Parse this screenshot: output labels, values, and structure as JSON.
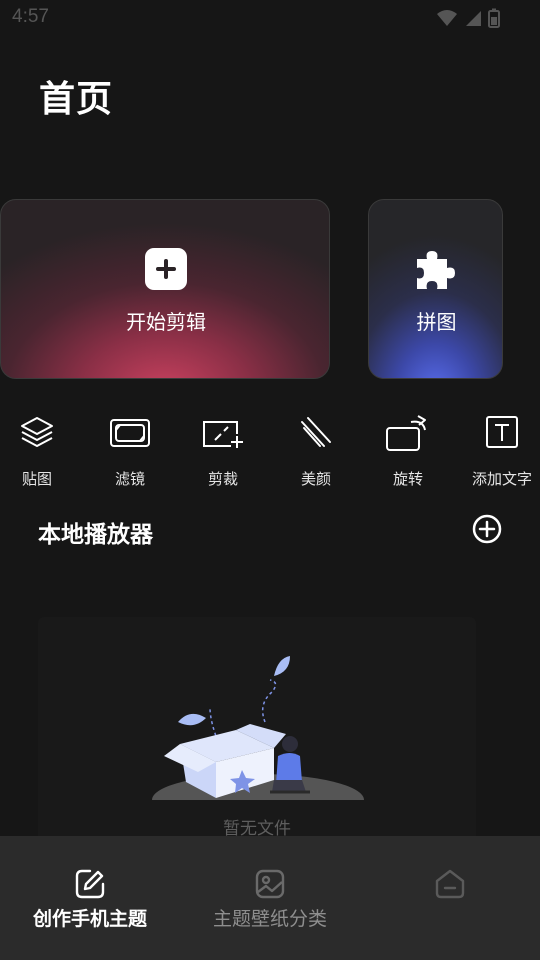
{
  "status_bar": {
    "time": "4:57",
    "icons": [
      "wifi-icon",
      "signal-icon",
      "battery-icon"
    ]
  },
  "page": {
    "title": "首页"
  },
  "cards": {
    "edit": {
      "label": "开始剪辑",
      "icon": "plus-square-icon"
    },
    "puzzle": {
      "label": "拼图",
      "icon": "puzzle-icon"
    }
  },
  "tools": [
    {
      "label": "贴图",
      "icon": "layers-icon"
    },
    {
      "label": "滤镜",
      "icon": "filter-frame-icon"
    },
    {
      "label": "剪裁",
      "icon": "crop-icon"
    },
    {
      "label": "美颜",
      "icon": "beauty-lines-icon"
    },
    {
      "label": "旋转",
      "icon": "rotate-icon"
    },
    {
      "label": "添加文字",
      "icon": "text-icon"
    }
  ],
  "local_player": {
    "title": "本地播放器",
    "add_icon": "plus-circle-icon",
    "empty_text": "暂无文件"
  },
  "bottom_nav": [
    {
      "label": "创作手机主题",
      "icon": "edit-icon",
      "active": true
    },
    {
      "label": "主题壁纸分类",
      "icon": "image-icon",
      "active": false
    },
    {
      "label": "",
      "icon": "profile-icon",
      "active": false
    }
  ],
  "colors": {
    "background": "#161616",
    "edit_card_accent": "#c9415f",
    "puzzle_card_accent": "#5a6ef0",
    "nav_background": "#2b2b2b"
  }
}
